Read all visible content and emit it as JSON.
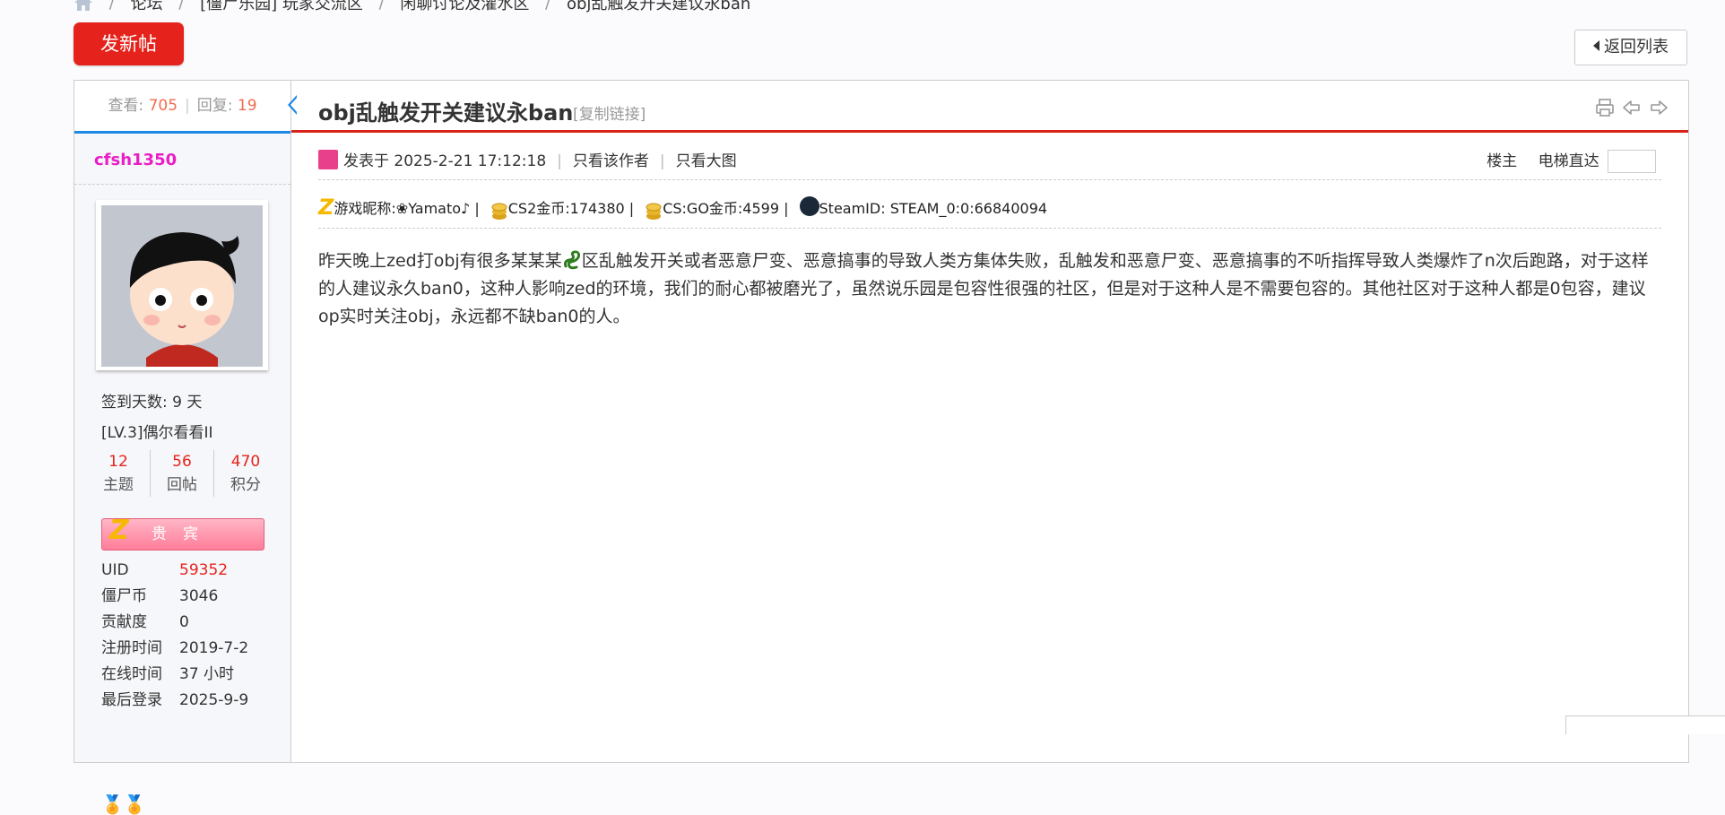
{
  "breadcrumb": {
    "items": [
      "论坛",
      "[僵尸乐园] 玩家交流区",
      "闲聊讨论及灌水区",
      "obj乱触发开关建议永ban"
    ]
  },
  "actions": {
    "new_post_label": "发新帖",
    "back_label": "返回列表"
  },
  "thread": {
    "views_label": "查看:",
    "views": "705",
    "replies_label": "回复:",
    "replies": "19",
    "title": "obj乱触发开关建议永ban",
    "copy_link": "[复制链接]"
  },
  "author": {
    "name": "cfsh1350",
    "checkin": "签到天数: 9 天",
    "level": "[LV.3]偶尔看看II",
    "counts": [
      {
        "value": "12",
        "label": "主题"
      },
      {
        "value": "56",
        "label": "回帖"
      },
      {
        "value": "470",
        "label": "积分"
      }
    ],
    "badge": "贵宾",
    "info": [
      {
        "key": "UID",
        "value": "59352"
      },
      {
        "key": "僵尸币",
        "value": "3046"
      },
      {
        "key": "贡献度",
        "value": "0"
      },
      {
        "key": "注册时间",
        "value": "2019-7-2"
      },
      {
        "key": "在线时间",
        "value": "37 小时"
      },
      {
        "key": "最后登录",
        "value": "2025-9-9"
      }
    ]
  },
  "post_meta": {
    "posted_at": "发表于 2025-2-21 17:12:18",
    "only_author": "只看该作者",
    "only_big_images": "只看大图",
    "floor_label": "楼主",
    "elevator_label": "电梯直达"
  },
  "game_info": {
    "nickname": "游戏昵称:❀Yamato♪ |",
    "cs2": "CS2金币:174380 |",
    "csgo": "CS:GO金币:4599 |",
    "steam": "SteamID: STEAM_0:0:66840094"
  },
  "content": {
    "before_icon": "昨天晚上zed打obj有很多某某某",
    "after_icon": "区乱触发开关或者恶意尸变、恶意搞事的导致人类方集体失败，乱触发和恶意尸变、恶意搞事的不听指挥导致人类爆炸了n次后跑路，对于这样的人建议永久ban0，这种人影响zed的环境，我们的耐心都被磨光了，虽然说乐园是包容性很强的社区，但是对于这种人是不需要包容的。其他社区对于这种人都是0包容，建议op实时关注obj，永远都不缺ban0的人。"
  },
  "icons": [
    "home-icon",
    "print-icon",
    "prev-thread-icon",
    "next-thread-icon",
    "user-icon",
    "coin-icon",
    "steam-icon",
    "snake-icon"
  ]
}
